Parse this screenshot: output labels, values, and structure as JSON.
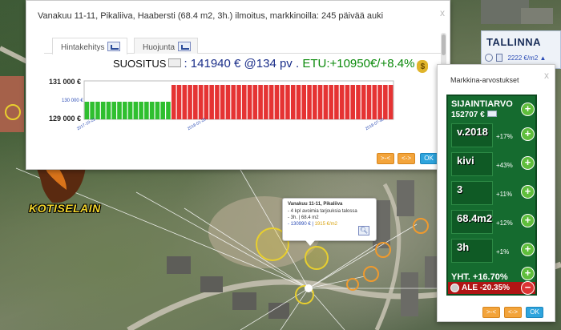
{
  "main_dialog": {
    "title": "Vanakuu 11-11, Pikaliiva, Haabersti (68.4 m2, 3h.) ilmoitus, markkinoilla: 245 päivää auki",
    "close_label": "x",
    "tabs": [
      {
        "label": "Hintakehitys"
      },
      {
        "label": "Huojunta"
      }
    ],
    "recommendation": {
      "label": "SUOSITUS",
      "text": ": 141940 € @134 pv .",
      "etu": "ETU:+10950€/+8.4%",
      "bag_symbol": "$"
    },
    "buttons": {
      "narrow": ">-<",
      "widen": "<->",
      "ok": "OK"
    }
  },
  "chart_data": {
    "type": "bar",
    "ylim": [
      128800,
      131200
    ],
    "y_tick_labels": [
      "131 000 €",
      "129 000 €"
    ],
    "y_mid_label": "130 000 €",
    "x_tick_labels": [
      "2017-10-22",
      "2018-01-28",
      "2018-07-30"
    ],
    "series": [
      {
        "color": "#2fbf2f",
        "values": [
          129900,
          129900,
          129900,
          129900,
          129900,
          129900,
          129900,
          129900,
          129900,
          129900,
          129900,
          129900,
          129900,
          129900,
          129900,
          129900
        ]
      },
      {
        "color": "#e53333",
        "values": [
          130950,
          130950,
          130950,
          130950,
          130950,
          130950,
          130950,
          130950,
          130950,
          130950,
          130950,
          130950,
          130950,
          130950,
          130950,
          130950,
          130950,
          130950,
          130950,
          130950,
          130950,
          130950,
          130950,
          130950,
          130950,
          130950,
          130950,
          130950,
          130950,
          130950,
          130950,
          130950,
          130950,
          130950,
          130950,
          130950,
          130950,
          130950,
          130950,
          130950,
          130950
        ]
      }
    ],
    "colors": {
      "green": "#2fbf2f",
      "red": "#e53333"
    }
  },
  "logo": {
    "text": "KOTISELAIN"
  },
  "popup": {
    "title": "Vanakuu 11-11, Pikaliiva",
    "lines": [
      "- 4 kpl avoimia tarjouksia talossa",
      "- 3h. | 68.4 m2"
    ],
    "price": "- 130990 € |",
    "sqm": "1915 €/m2",
    "zoom_icon": "magnifier-icon"
  },
  "city": {
    "name": "TALLINNA",
    "price": "2222 €/m2 ▲"
  },
  "valuation_dialog": {
    "title": "Markkina-arvostukset",
    "close_label": "x",
    "location_label": "SIJAINTIARVO",
    "location_value": "152707 €",
    "factors": [
      {
        "tile": "v.2018",
        "pct": "+17%"
      },
      {
        "tile": "kivi",
        "pct": "+43%"
      },
      {
        "tile": "3",
        "pct": "+11%"
      },
      {
        "tile": "68.4m2",
        "pct": "+12%"
      },
      {
        "tile": "3h",
        "pct": "+1%"
      }
    ],
    "total": "YHT. +16.70%",
    "discount": "ALE -20.35%",
    "buttons": {
      "narrow": ">-<",
      "widen": "<->",
      "ok": "OK"
    }
  }
}
